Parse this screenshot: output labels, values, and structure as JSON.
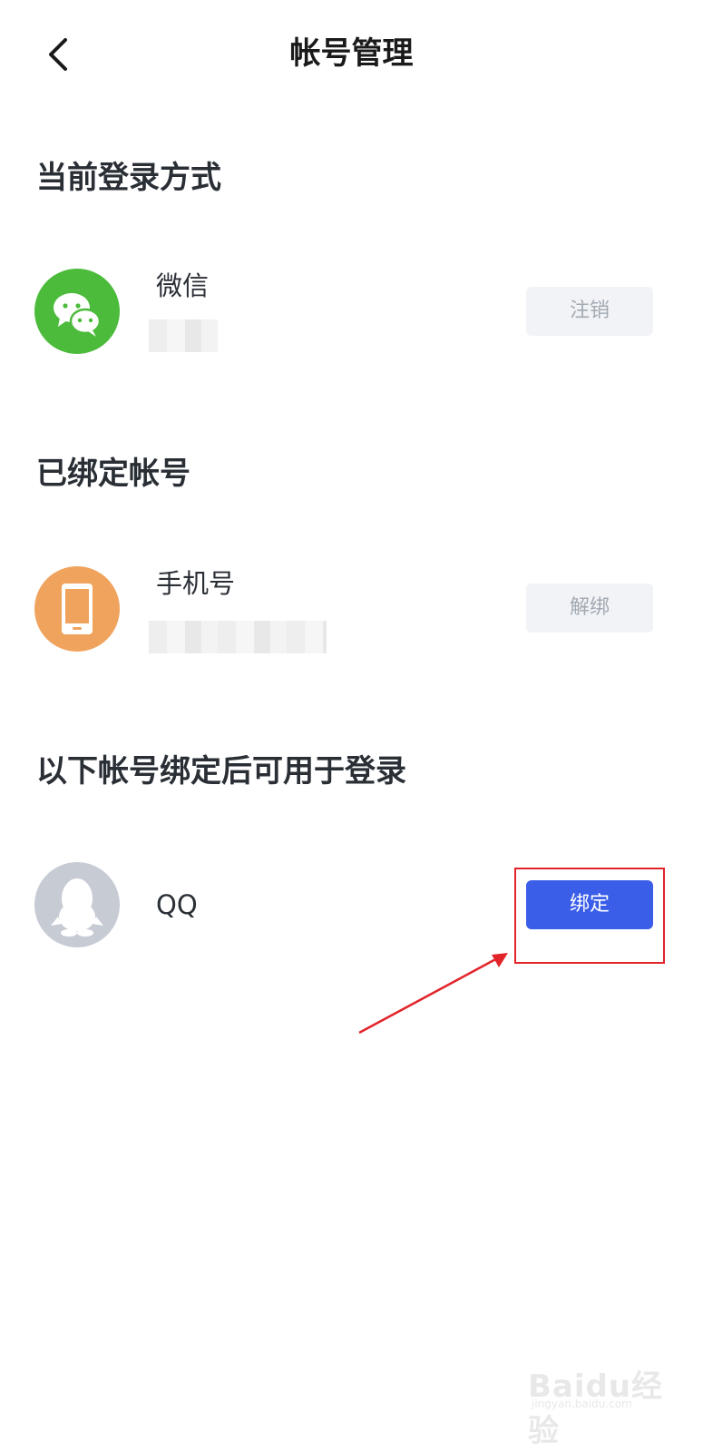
{
  "header": {
    "title": "帐号管理",
    "back_icon": "chevron-left-icon"
  },
  "sections": {
    "current_login": {
      "title": "当前登录方式",
      "account": {
        "name": "微信",
        "icon": "wechat-icon",
        "icon_color": "#4CBB3C",
        "button_label": "注销"
      }
    },
    "bound_accounts": {
      "title": "已绑定帐号",
      "account": {
        "name": "手机号",
        "icon": "phone-icon",
        "icon_color": "#F0A35D",
        "button_label": "解绑"
      }
    },
    "bindable": {
      "title": "以下帐号绑定后可用于登录",
      "account": {
        "name": "QQ",
        "icon": "qq-penguin-icon",
        "icon_color": "#C7CBD4",
        "button_label": "绑定"
      }
    }
  },
  "annotation": {
    "highlight_color": "#E2232A"
  },
  "watermark": {
    "text": "Baidu经验",
    "sub": "jingyan.baidu.com"
  },
  "colors": {
    "accent": "#3A5EE8",
    "button_gray_bg": "#F1F3F6",
    "button_gray_text": "#A3A9B2"
  }
}
